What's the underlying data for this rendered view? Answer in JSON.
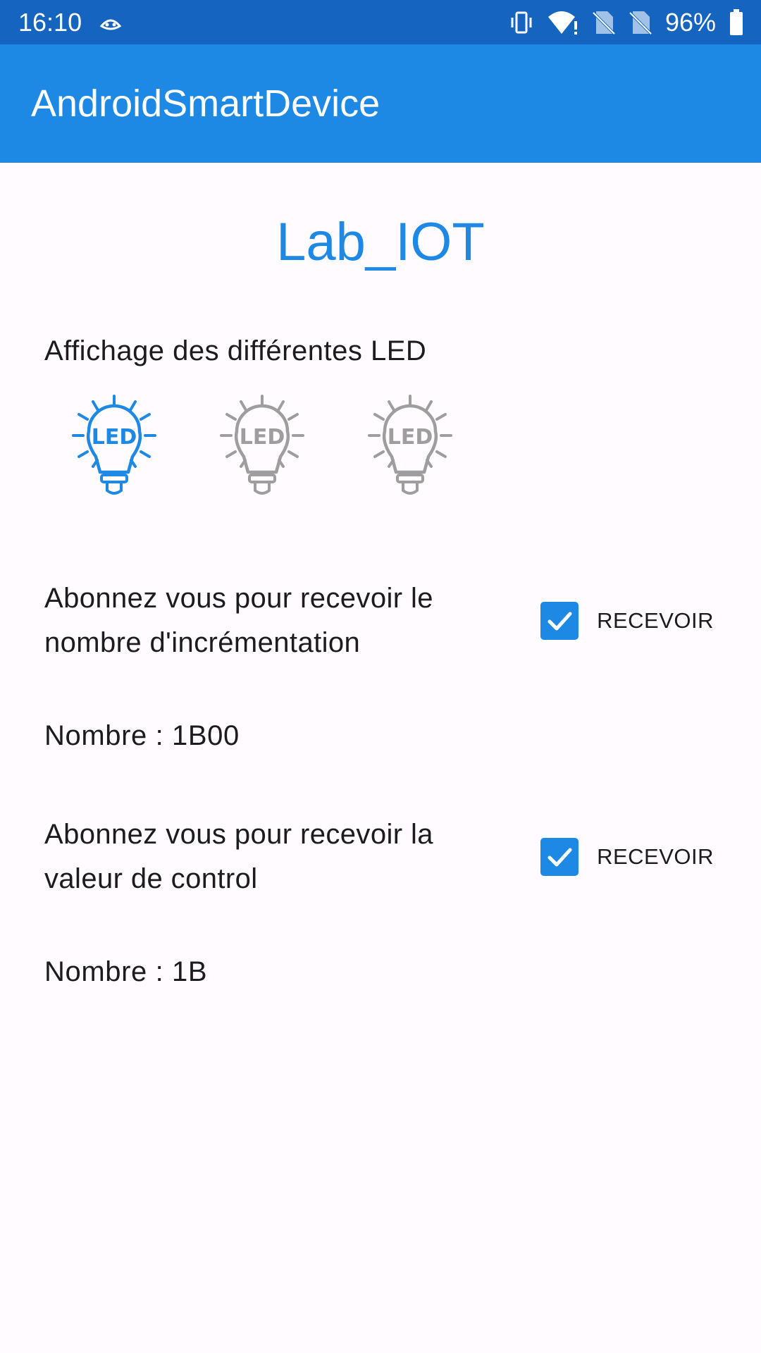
{
  "status_bar": {
    "time": "16:10",
    "battery": "96%",
    "icons": [
      "android-auto-icon",
      "vibrate-icon",
      "wifi-icon",
      "no-sim-icon",
      "no-sim-icon",
      "battery-icon"
    ]
  },
  "app_bar": {
    "title": "AndroidSmartDevice"
  },
  "main": {
    "title": "Lab_IOT",
    "led_section_label": "Affichage des différentes LED",
    "leds": [
      {
        "label": "LED",
        "state": "on",
        "color": "#1e88e5"
      },
      {
        "label": "LED",
        "state": "off",
        "color": "#9e9e9e"
      },
      {
        "label": "LED",
        "state": "off",
        "color": "#9e9e9e"
      }
    ],
    "subscriptions": [
      {
        "text": "Abonnez vous pour recevoir le nombre d'incrémentation",
        "checkbox_label": "RECEVOIR",
        "checked": true,
        "value_line": "Nombre :  1B00"
      },
      {
        "text": "Abonnez vous pour recevoir la valeur de control",
        "checkbox_label": "RECEVOIR",
        "checked": true,
        "value_line": "Nombre :  1B"
      }
    ]
  },
  "colors": {
    "status_bar": "#1565c0",
    "app_bar": "#1e88e5",
    "accent": "#1e88e5",
    "led_off": "#9e9e9e"
  }
}
